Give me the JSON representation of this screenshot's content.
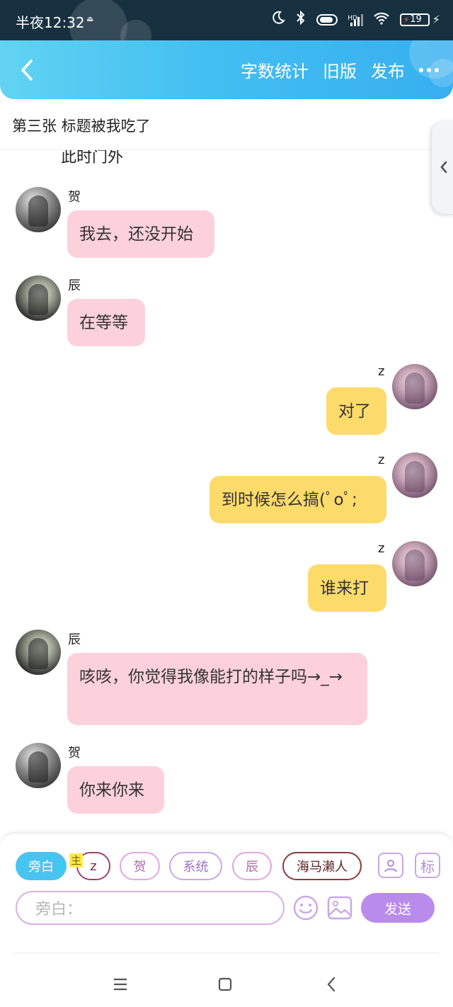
{
  "status_bar": {
    "time": "半夜12:32",
    "tiny_label": "⏏",
    "network_label": "HD",
    "battery_level": "19"
  },
  "header": {
    "actions": [
      "字数统计",
      "旧版",
      "发布"
    ]
  },
  "title_bar": {
    "chapter": "第三张  标题被我吃了"
  },
  "chat": {
    "cut_text": "此时门外",
    "messages": [
      {
        "sender": "贺",
        "side": "left",
        "text": "我去，还没开始"
      },
      {
        "sender": "辰",
        "side": "left",
        "text": "在等等"
      },
      {
        "sender": "z",
        "side": "right",
        "text": "对了"
      },
      {
        "sender": "z",
        "side": "right",
        "text": "到时候怎么搞(ﾟoﾟ;"
      },
      {
        "sender": "z",
        "side": "right",
        "text": "谁来打"
      },
      {
        "sender": "辰",
        "side": "left",
        "text": "咳咳，你觉得我像能打的样子吗→_→"
      },
      {
        "sender": "贺",
        "side": "left",
        "text": "你来你来"
      }
    ]
  },
  "input_panel": {
    "roles": [
      "旁白",
      "z",
      "贺",
      "系统",
      "辰",
      "海马濑人"
    ],
    "host_tag": "主",
    "mark_button": "标",
    "input_placeholder": "旁白：",
    "send_label": "发送"
  },
  "colors": {
    "header_gradient": [
      "#62d3f2",
      "#37aff0"
    ],
    "bubble_left": "#fcd1dc",
    "bubble_right": "#fddb6b",
    "send_button": "#b98bea",
    "active_chip": "#49c4f1"
  }
}
